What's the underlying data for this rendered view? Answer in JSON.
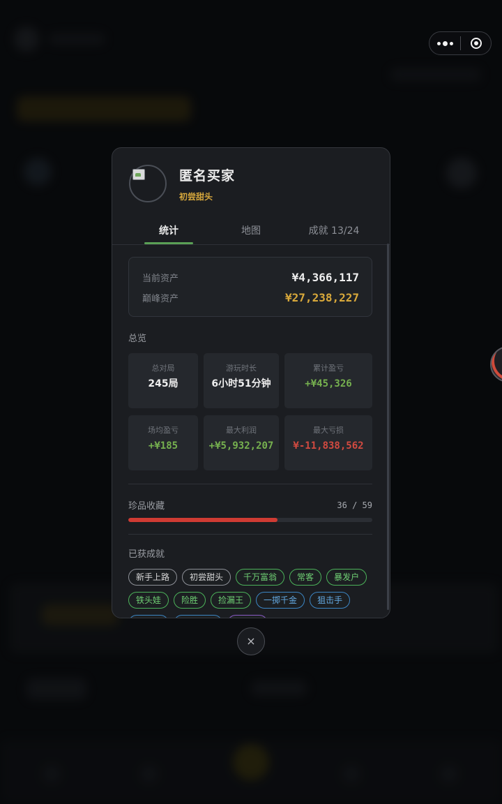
{
  "profile": {
    "name": "匿名买家",
    "title": "初尝甜头"
  },
  "tabs": [
    {
      "label": "统计",
      "active": true
    },
    {
      "label": "地图",
      "active": false
    },
    {
      "label": "成就 13/24",
      "active": false
    }
  ],
  "assets": {
    "current_label": "当前资产",
    "current_value": "¥4,366,117",
    "peak_label": "巅峰资产",
    "peak_value": "¥27,238,227"
  },
  "overview": {
    "title": "总览",
    "stats": [
      {
        "label": "总对局",
        "value": "245局",
        "tone": "white"
      },
      {
        "label": "游玩时长",
        "value": "6小时51分钟",
        "tone": "white"
      },
      {
        "label": "累计盈亏",
        "value": "+¥45,326",
        "tone": "green"
      },
      {
        "label": "场均盈亏",
        "value": "+¥185",
        "tone": "green"
      },
      {
        "label": "最大利润",
        "value": "+¥5,932,207",
        "tone": "green"
      },
      {
        "label": "最大亏损",
        "value": "¥-11,838,562",
        "tone": "red"
      }
    ]
  },
  "collection": {
    "label": "珍品收藏",
    "count": "36 / 59",
    "progress": 0.61
  },
  "achievements": {
    "title": "已获成就",
    "badges": [
      {
        "label": "新手上路",
        "tone": "gray"
      },
      {
        "label": "初尝甜头",
        "tone": "gray"
      },
      {
        "label": "千万富翁",
        "tone": "green"
      },
      {
        "label": "常客",
        "tone": "green"
      },
      {
        "label": "暴发户",
        "tone": "green"
      },
      {
        "label": "铁头娃",
        "tone": "green"
      },
      {
        "label": "险胜",
        "tone": "green"
      },
      {
        "label": "捡漏王",
        "tone": "green"
      },
      {
        "label": "一掷千金",
        "tone": "blue"
      },
      {
        "label": "狙击手",
        "tone": "blue"
      },
      {
        "label": "鉴赏家",
        "tone": "blue"
      },
      {
        "label": "四海为家",
        "tone": "blue"
      },
      {
        "label": "铁公鸡",
        "tone": "purple"
      }
    ]
  },
  "close_label": "×",
  "colors": {
    "accent_green": "#5aa055",
    "gold": "#d9a93b",
    "profit_green": "#76b14f",
    "loss_red": "#d24a40",
    "progress_red": "#cf3b33"
  }
}
